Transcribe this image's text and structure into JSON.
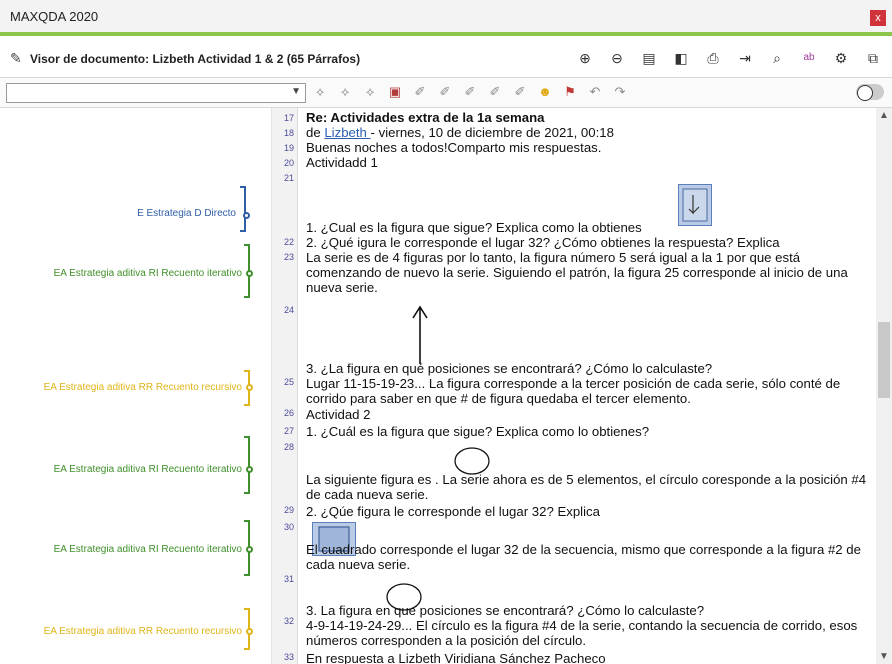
{
  "app": {
    "title": "MAXQDA 2020",
    "close_label": "x"
  },
  "viewer": {
    "title": "Visor de documento: Lizbeth Actividad 1 & 2  (65 Párrafos)"
  },
  "codes": [
    {
      "label": "E Estrategia D Directo",
      "color": "#2f5ea6"
    },
    {
      "label": "EA Estrategia aditiva RI Recuento iterativo",
      "color": "#3f8f2a"
    },
    {
      "label": "EA Estrategia aditiva RR Recuento recursivo",
      "color": "#e0b418"
    },
    {
      "label": "EA Estrategia aditiva RI Recuento iterativo",
      "color": "#3f8f2a"
    },
    {
      "label": "EA Estrategia aditiva RI Recuento iterativo",
      "color": "#3f8f2a"
    },
    {
      "label": "EA Estrategia aditiva RR Recuento recursivo",
      "color": "#e0b418"
    }
  ],
  "paragraphs": [
    {
      "num": "17",
      "text": "Re: Actividades extra de la 1a semana",
      "bold": true
    },
    {
      "num": "18",
      "pre": "de ",
      "link": "Lizbeth ",
      "post": " - viernes, 10 de diciembre de 2021, 00:18"
    },
    {
      "num": "19",
      "text": "Buenas noches a todos!Comparto mis respuestas."
    },
    {
      "num": "20",
      "text": "Actividadd 1"
    },
    {
      "num": "21",
      "text": "1. ¿Cual es la figura que sigue? Explica como la obtienes"
    },
    {
      "num": "22",
      "text": "2. ¿Qué igura le corresponde el lugar 32? ¿Cómo obtienes la respuesta? Explica"
    },
    {
      "num": "23",
      "text": "La serie es de 4 figuras por lo tanto, la figura número 5 será igual a la 1 por que está comenzando de nuevo la serie. Siguiendo el patrón, la figura 25 corresponde al inicio de una nueva serie."
    },
    {
      "num": "24",
      "text": "3. ¿La figura              en qué posiciones se encontrará? ¿Cómo lo calculaste?"
    },
    {
      "num": "25",
      "text": "Lugar 11-15-19-23... La figura corresponde a la tercer posición de cada serie, sólo conté de corrido para saber en que # de figura quedaba el tercer elemento."
    },
    {
      "num": "26",
      "text": "Actividad 2"
    },
    {
      "num": "27",
      "text": "1. ¿Cuál es la figura que sigue? Explica como lo obtienes?"
    },
    {
      "num": "28",
      "text": "La siguiente figura es              . La serie ahora es de 5 elementos, el círculo coresponde a la posición #4 de cada nueva serie."
    },
    {
      "num": "29",
      "text": "2. ¿Qúe figura le corresponde el lugar 32? Explica"
    },
    {
      "num": "30",
      "text": "             El cuadrado corresponde el lugar 32 de la secuencia, mismo que corresponde a la figura #2 de cada nueva serie."
    },
    {
      "num": "31",
      "text": "3. La figura             en que posiciones se encontrará? ¿Cómo lo calculaste?"
    },
    {
      "num": "32",
      "text": "4-9-14-19-24-29... El círculo es la figura #4 de la serie, contando la secuencia de corrido, esos números corresponden a la posición del círculo."
    },
    {
      "num": "33",
      "text": "En respuesta a Lizbeth Viridiana Sánchez Pacheco"
    }
  ]
}
